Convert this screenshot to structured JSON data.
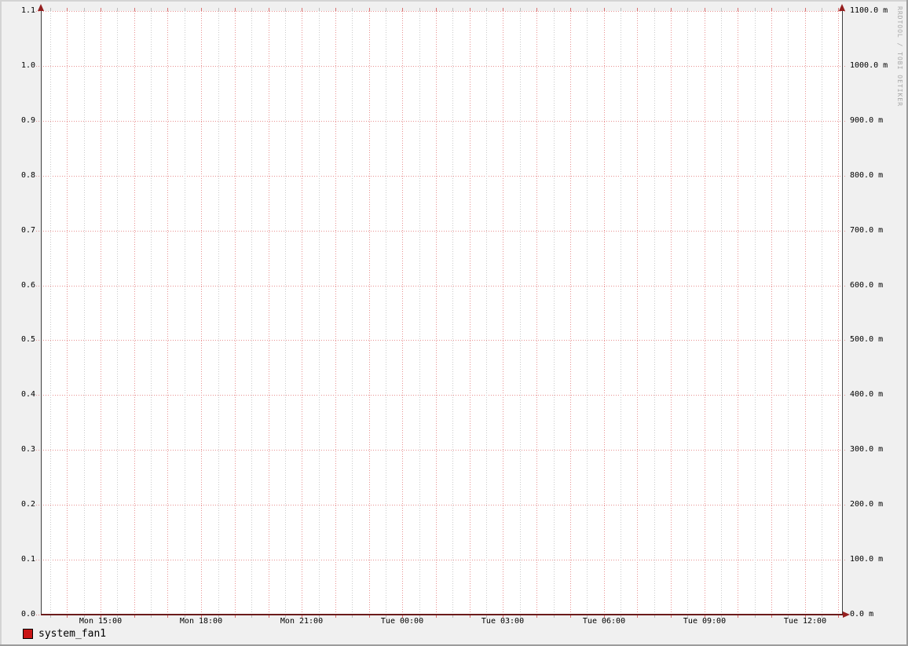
{
  "watermark": "RRDTOOL / TOBI OETIKER",
  "legend": {
    "items": [
      {
        "label": "system_fan1",
        "swatch_color": "#c91515"
      }
    ]
  },
  "chart_data": {
    "type": "line",
    "title": "",
    "x_axis": {
      "tick_labels": [
        "Mon 15:00",
        "Mon 18:00",
        "Mon 21:00",
        "Tue 00:00",
        "Tue 03:00",
        "Tue 06:00",
        "Tue 09:00",
        "Tue 12:00"
      ],
      "label_interval_hours": 3,
      "major_grid_minutes": 60,
      "minor_grid_minutes": 30
    },
    "y_left_axis": {
      "tick_labels_top_down": [
        "1.1",
        "1.0",
        "0.9",
        "0.8",
        "0.7",
        "0.6",
        "0.5",
        "0.4",
        "0.3",
        "0.2",
        "0.1",
        "0.0"
      ],
      "min": 0.0,
      "max": 1.1
    },
    "y_right_axis": {
      "tick_labels_top_down": [
        "1100.0 m",
        "1000.0 m",
        "900.0 m",
        "800.0 m",
        "700.0 m",
        "600.0 m",
        "500.0 m",
        "400.0 m",
        "300.0 m",
        "200.0 m",
        "100.0 m",
        "0.0 m"
      ],
      "min": 0.0,
      "max": 1100.0,
      "unit": "m"
    },
    "series": [
      {
        "name": "system_fan1",
        "color": "#c91515",
        "x": [
          "Mon 15:00",
          "Mon 18:00",
          "Mon 21:00",
          "Tue 00:00",
          "Tue 03:00",
          "Tue 06:00",
          "Tue 09:00",
          "Tue 12:00"
        ],
        "values": [
          0,
          0,
          0,
          0,
          0,
          0,
          0,
          0
        ]
      }
    ],
    "grid": {
      "on": true,
      "major_color": "#e89090",
      "minor_color": "#c9c9c9",
      "legend_position": "bottom-left"
    }
  },
  "colors": {
    "background": "#f0f0f0",
    "canvas": "#ffffff",
    "axis": "#3f3f3f",
    "x_axis_line": "#6b1b1b",
    "arrow": "#941f1f",
    "major_tick": "#d97070",
    "minor_tick": "#bdbdbd",
    "border_light": "#d4d4d4",
    "border_dark": "#9c9c9c",
    "watermark_text": "#a8a8a8"
  }
}
